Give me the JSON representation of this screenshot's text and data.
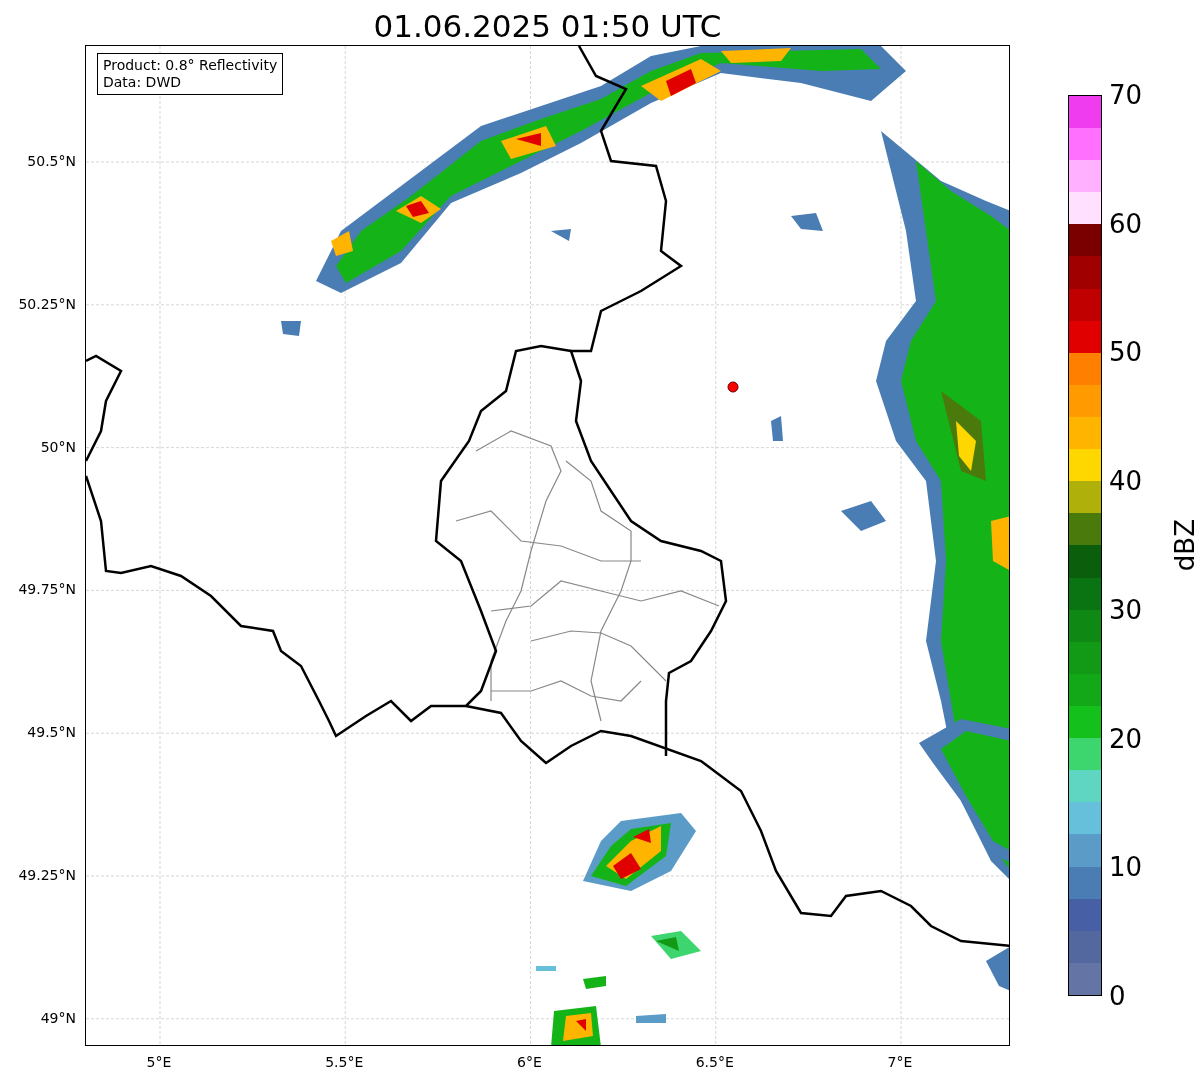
{
  "title": "01.06.2025 01:50 UTC",
  "annotation": [
    "Product: 0.8° Reflectivity",
    "Data: DWD"
  ],
  "map": {
    "y_ticks": [
      "50.5°N",
      "50.25°N",
      "50°N",
      "49.75°N",
      "49.5°N",
      "49.25°N",
      "49°N"
    ],
    "x_ticks": [
      "5°E",
      "5.5°E",
      "6°E",
      "6.5°E",
      "7°E"
    ]
  },
  "colorbar": {
    "label": "dBZ",
    "ticks": [
      "70",
      "60",
      "50",
      "40",
      "30",
      "20",
      "10",
      "0"
    ],
    "bins": [
      {
        "color": "#6475a5"
      },
      {
        "color": "#5468a0"
      },
      {
        "color": "#4760a5"
      },
      {
        "color": "#4a7db4"
      },
      {
        "color": "#5a9bc8"
      },
      {
        "color": "#66c0dc"
      },
      {
        "color": "#5ed6c2"
      },
      {
        "color": "#3dd56e"
      },
      {
        "color": "#14c01c"
      },
      {
        "color": "#12a818"
      },
      {
        "color": "#129a16"
      },
      {
        "color": "#0f8814"
      },
      {
        "color": "#0b7412"
      },
      {
        "color": "#0a5e0c"
      },
      {
        "color": "#4a7a0c"
      },
      {
        "color": "#afb00a"
      },
      {
        "color": "#ffd700"
      },
      {
        "color": "#ffb400"
      },
      {
        "color": "#ff9a00"
      },
      {
        "color": "#ff7f00"
      },
      {
        "color": "#e00000"
      },
      {
        "color": "#c00000"
      },
      {
        "color": "#a00000"
      },
      {
        "color": "#7a0000"
      },
      {
        "color": "#ffe0ff"
      },
      {
        "color": "#ffb0ff"
      },
      {
        "color": "#ff70ff"
      },
      {
        "color": "#ee3cee"
      }
    ]
  }
}
